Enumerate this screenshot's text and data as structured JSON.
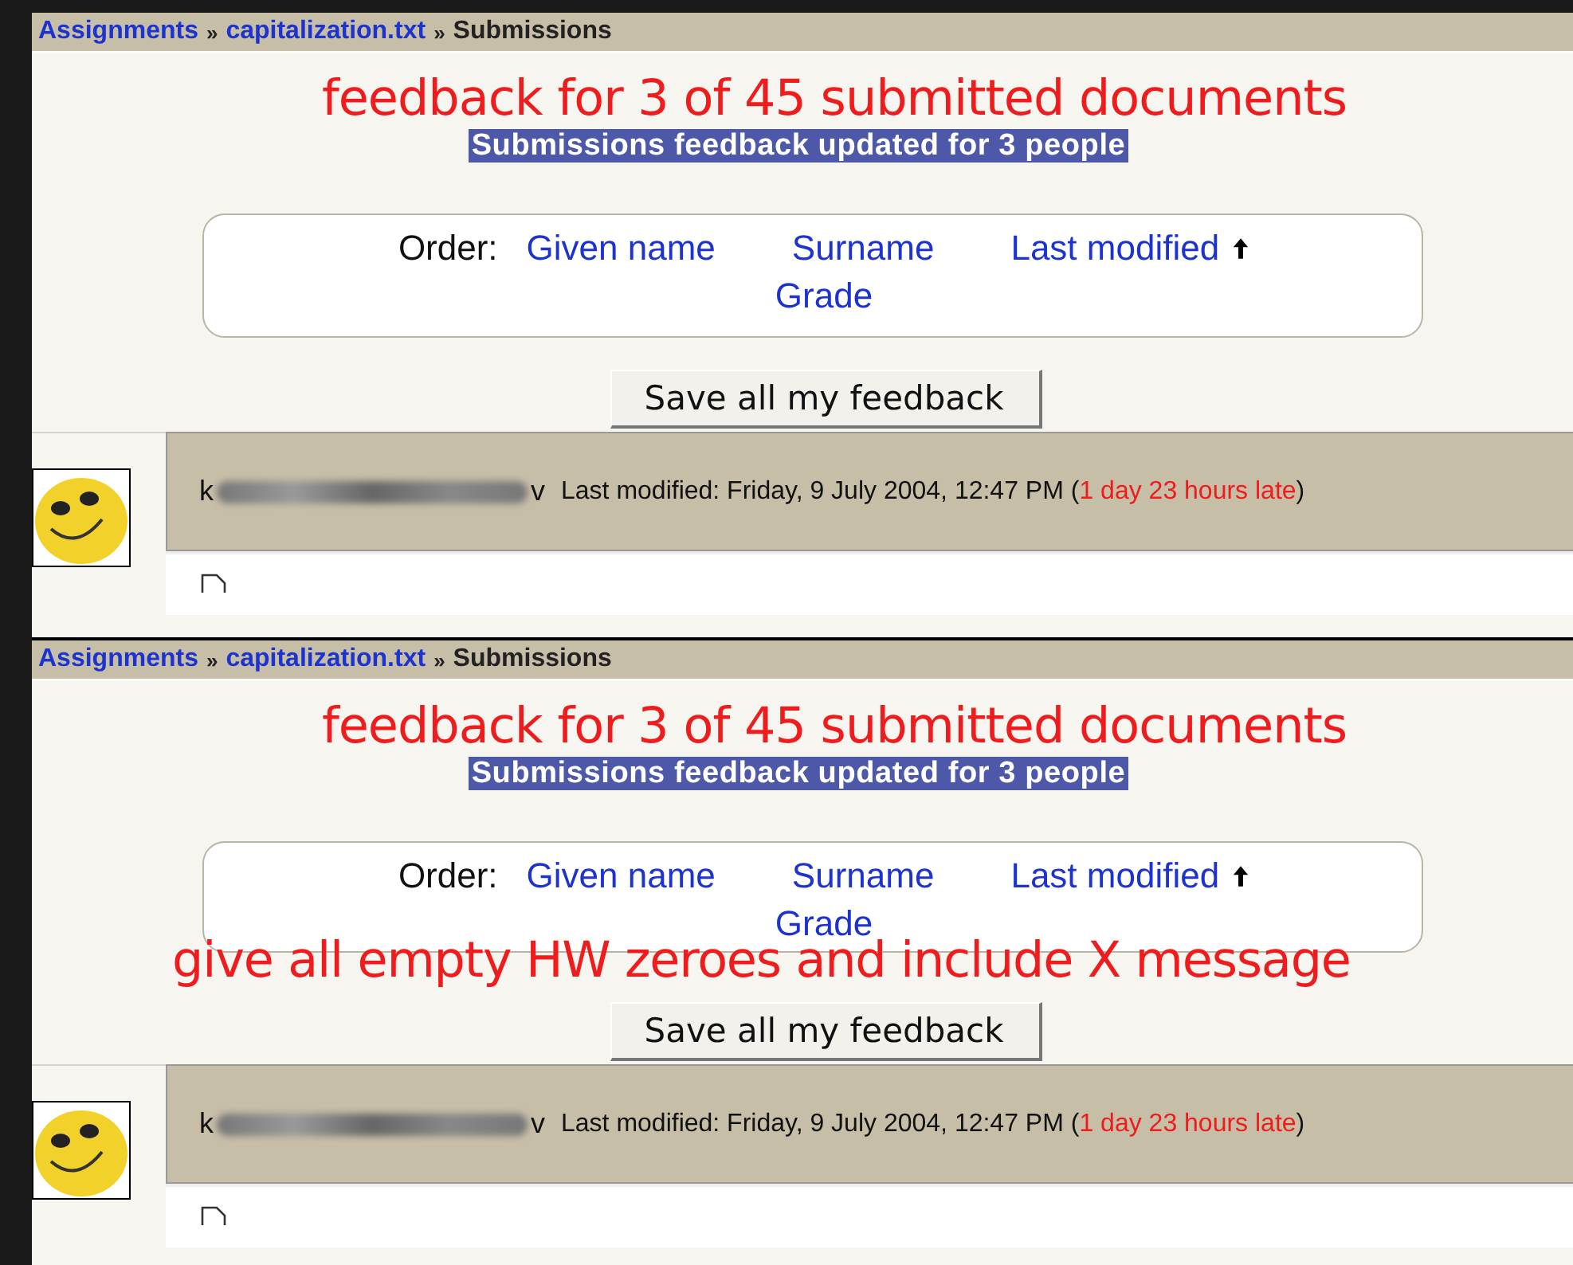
{
  "panels": [
    {
      "breadcrumb": [
        {
          "label": "Assignments",
          "link": true
        },
        {
          "label": "capitalization.txt",
          "link": true
        },
        {
          "label": "Submissions",
          "link": false
        }
      ],
      "separator": "»",
      "annotation": "feedback for 3 of 45 submitted documents",
      "notice": "Submissions feedback updated for 3 people",
      "order": {
        "label": "Order:",
        "links": [
          {
            "label": "Given name",
            "sorted": false
          },
          {
            "label": "Surname",
            "sorted": false
          },
          {
            "label": "Last modified",
            "sorted": true
          },
          {
            "label": "Grade",
            "sorted": false
          }
        ]
      },
      "save_button": "Save all my feedback",
      "submission": {
        "name_start": "k",
        "name_end": "v",
        "modified": "Last modified: Friday, 9 July 2004, 12:47 PM (",
        "late": "1 day 23 hours late",
        "close": ")"
      }
    },
    {
      "breadcrumb": [
        {
          "label": "Assignments",
          "link": true
        },
        {
          "label": "capitalization.txt",
          "link": true
        },
        {
          "label": "Submissions",
          "link": false
        }
      ],
      "separator": "»",
      "annotation": "feedback for 3 of 45 submitted documents",
      "notice": "Submissions feedback updated for 3 people",
      "order": {
        "label": "Order:",
        "links": [
          {
            "label": "Given name",
            "sorted": false
          },
          {
            "label": "Surname",
            "sorted": false
          },
          {
            "label": "Last modified",
            "sorted": true
          },
          {
            "label": "Grade",
            "sorted": false
          }
        ]
      },
      "overlay_note": "give all empty HW zeroes and include X message",
      "save_button": "Save all my feedback",
      "submission": {
        "name_start": "k",
        "name_end": "v",
        "modified": "Last modified: Friday, 9 July 2004, 12:47 PM (",
        "late": "1 day 23 hours late",
        "close": ")"
      }
    }
  ]
}
